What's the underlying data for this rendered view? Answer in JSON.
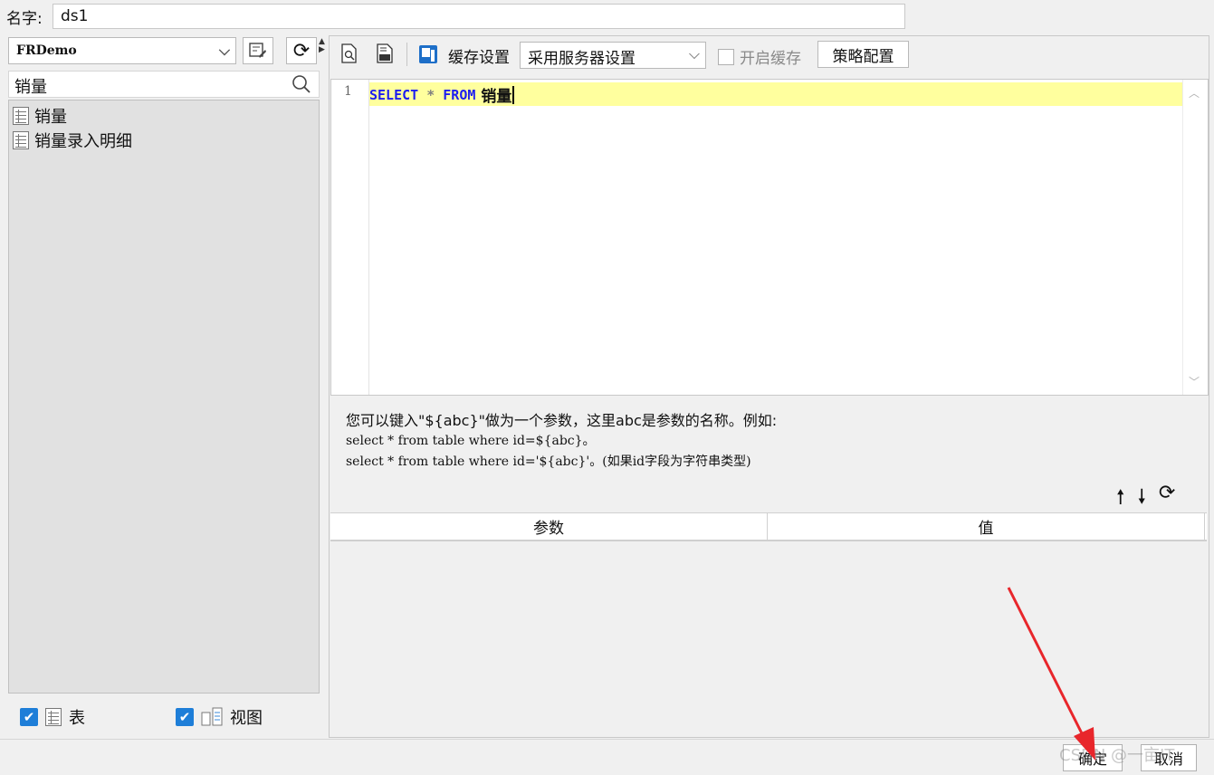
{
  "name_row": {
    "label": "名字:",
    "value": "ds1"
  },
  "left": {
    "connection": "FRDemo",
    "search_value": "销量",
    "tree_items": [
      {
        "label": "销量"
      },
      {
        "label": "销量录入明细"
      }
    ],
    "filters": {
      "table_label": "表",
      "view_label": "视图"
    }
  },
  "toolbar": {
    "cache_settings_label": "缓存设置",
    "cache_mode": "采用服务器设置",
    "enable_cache_label": "开启缓存",
    "strategy_label": "策略配置"
  },
  "editor": {
    "line_number": "1",
    "sql": {
      "kw1": "SELECT",
      "op": " * ",
      "kw2": "FROM",
      "ident": " 销量"
    }
  },
  "hint": {
    "line1": "您可以键入\"${abc}\"做为一个参数，这里abc是参数的名称。例如:",
    "line2": "select * from table where id=${abc}。",
    "line3": "select * from table where id='${abc}'。(如果id字段为字符串类型)"
  },
  "params": {
    "col_param": "参数",
    "col_value": "值"
  },
  "buttons": {
    "ok": "确定",
    "cancel": "取消"
  },
  "watermark": "CSDN @一亩IT",
  "colors": {
    "accent": "#1e7ed8",
    "sql_keyword": "#1d1df0",
    "line_highlight": "#ffff9e",
    "annotation_arrow": "#e8262b"
  }
}
